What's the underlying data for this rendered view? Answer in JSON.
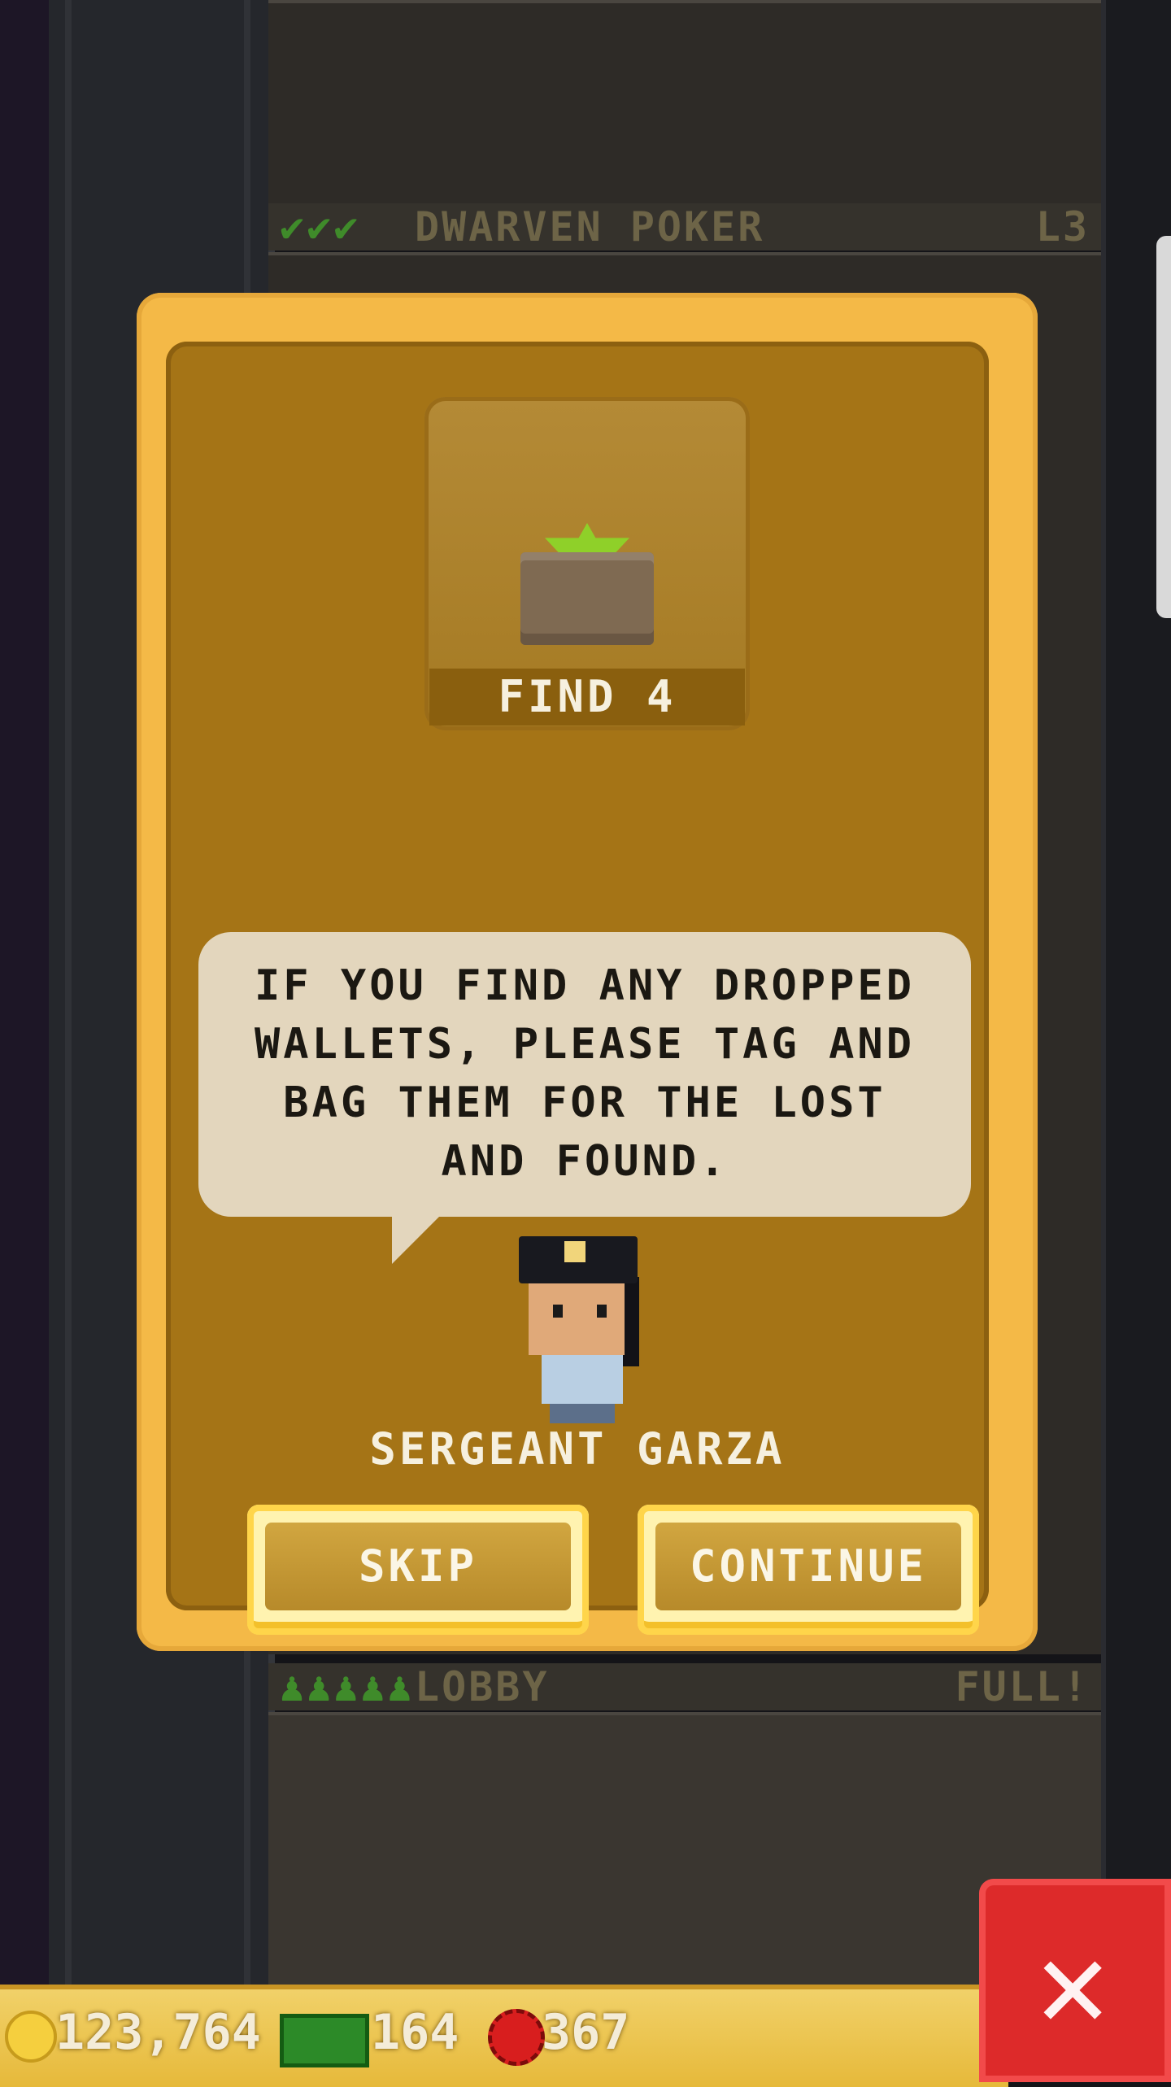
{
  "background": {
    "floors": [
      {
        "label": "DWARVEN POKER",
        "level": "L3",
        "checks": "✔✔✔"
      },
      {
        "label": "LOBBY",
        "level": "FULL!",
        "checks": "♟♟♟♟♟"
      }
    ]
  },
  "modal": {
    "reward": {
      "icon": "sprout-pot-icon",
      "label": "FIND 4"
    },
    "dialogue": "IF YOU FIND ANY DROPPED WALLETS, PLEASE TAG AND BAG THEM FOR THE LOST AND FOUND.",
    "character_name": "SERGEANT GARZA",
    "buttons": {
      "skip": "SKIP",
      "continue": "CONTINUE"
    }
  },
  "hud": {
    "coins": "123,764",
    "bux": "164",
    "tokens": "367",
    "close_icon": "close-x-icon"
  },
  "colors": {
    "modal_outer": "#f4b947",
    "modal_inner": "#a57416",
    "bubble": "#e3d6bd",
    "close_button": "#dd2a2a"
  }
}
